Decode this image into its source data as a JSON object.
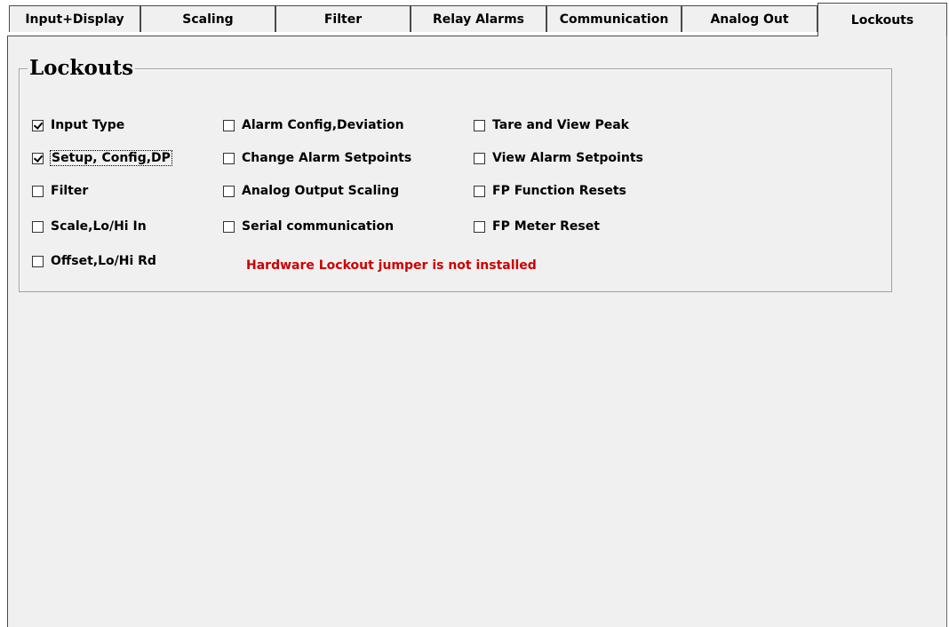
{
  "tabs": [
    {
      "label": "Input+Display"
    },
    {
      "label": "Scaling"
    },
    {
      "label": "Filter"
    },
    {
      "label": "Relay Alarms"
    },
    {
      "label": "Communication"
    },
    {
      "label": "Analog Out"
    },
    {
      "label": "Lockouts",
      "active": true
    }
  ],
  "group": {
    "title": "Lockouts",
    "options": [
      {
        "label": "Input Type",
        "checked": true
      },
      {
        "label": "Setup, Config,DP",
        "checked": true
      },
      {
        "label": "Filter",
        "checked": false
      },
      {
        "label": "Scale,Lo/Hi In",
        "checked": false
      },
      {
        "label": "Offset,Lo/Hi Rd",
        "checked": false
      },
      {
        "label": "Alarm Config,Deviation",
        "checked": false
      },
      {
        "label": "Change Alarm Setpoints",
        "checked": false
      },
      {
        "label": "Analog Output Scaling",
        "checked": false
      },
      {
        "label": "Serial communication",
        "checked": false
      },
      {
        "label": "Tare and View Peak",
        "checked": false
      },
      {
        "label": "View Alarm Setpoints",
        "checked": false
      },
      {
        "label": "FP Function Resets",
        "checked": false
      },
      {
        "label": "FP Meter Reset",
        "checked": false
      }
    ],
    "warning": "Hardware Lockout jumper is not installed"
  },
  "colors": {
    "warning": "#cc0000",
    "panel": "#f0f0f0"
  }
}
